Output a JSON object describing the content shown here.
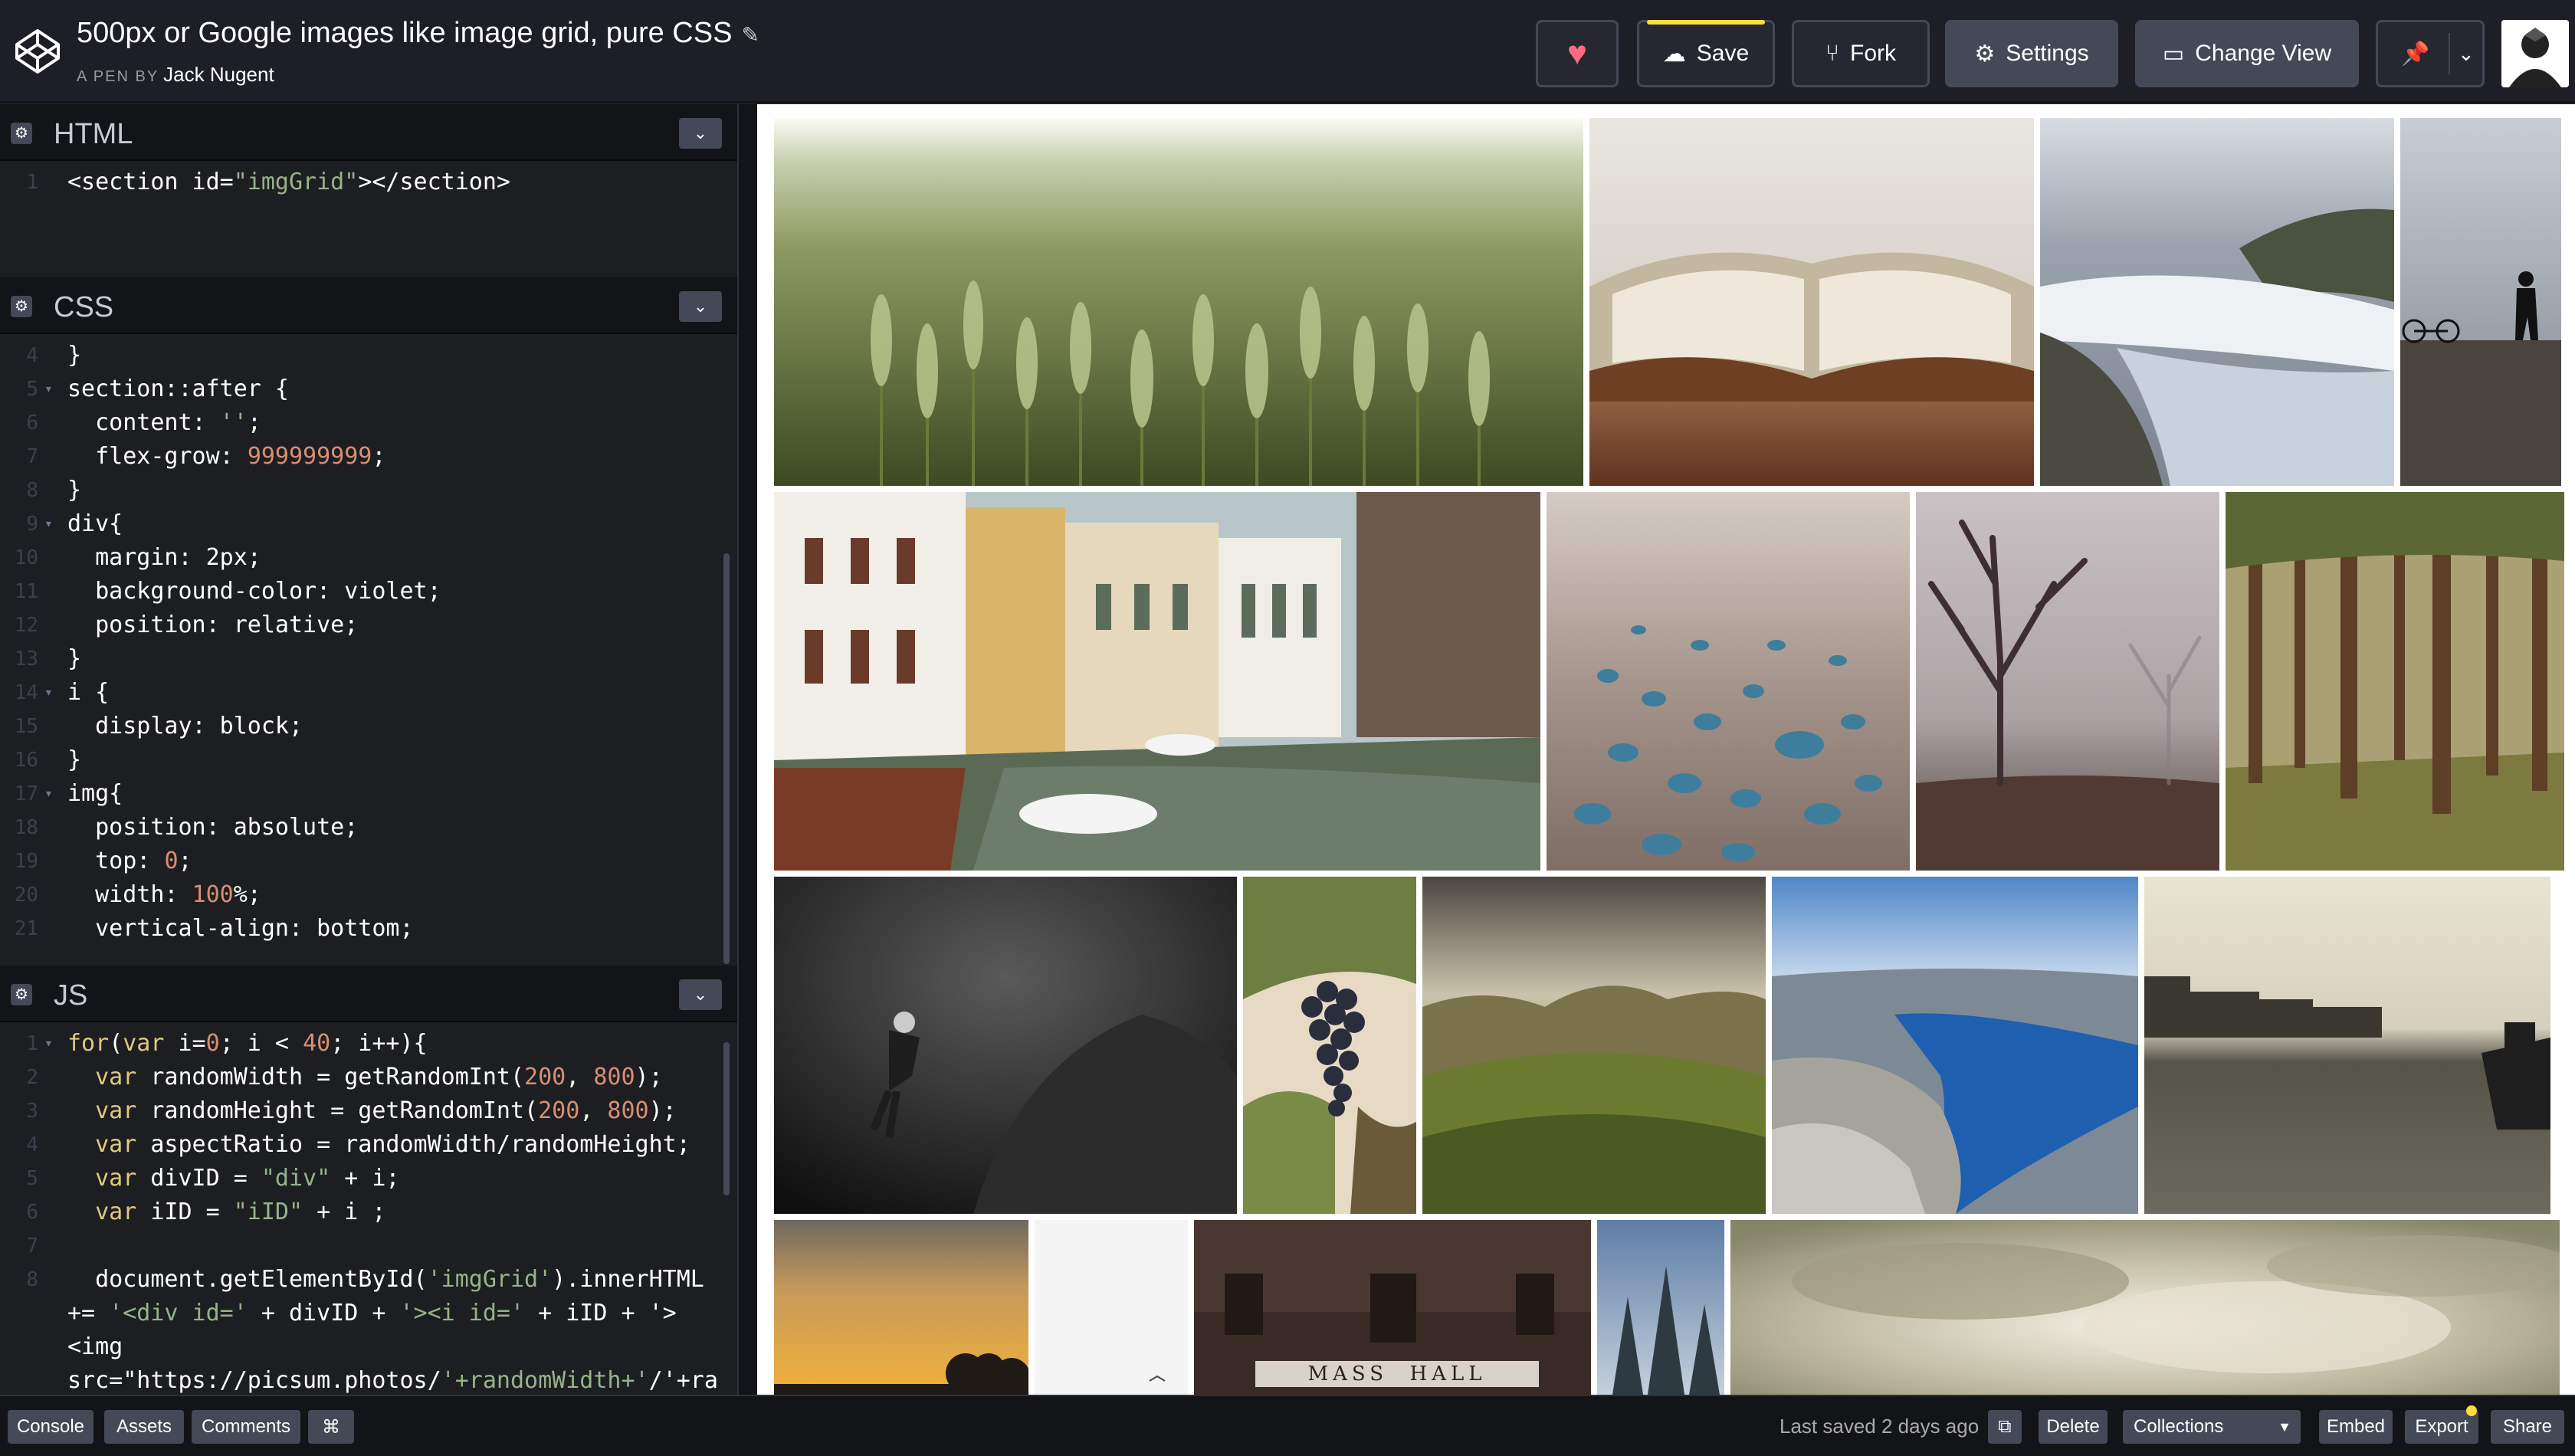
{
  "header": {
    "title": "500px or Google images like image grid, pure CSS",
    "pen_by_prefix": "A PEN BY",
    "author": "Jack Nugent",
    "buttons": {
      "save": "Save",
      "fork": "Fork",
      "settings": "Settings",
      "change_view": "Change View"
    },
    "icons": {
      "heart": "heart-icon",
      "save": "cloud-icon",
      "fork": "fork-icon",
      "settings": "gear-icon",
      "change_view": "view-icon",
      "pin": "pin-icon"
    }
  },
  "editors": {
    "html": {
      "title": "HTML",
      "lines": [
        {
          "n": "1",
          "code": "<section id=\"imgGrid\"></section>"
        }
      ]
    },
    "css": {
      "title": "CSS",
      "lines": [
        {
          "n": "4",
          "code": "}"
        },
        {
          "n": "5",
          "code": "section::after {"
        },
        {
          "n": "6",
          "code": "  content: '';"
        },
        {
          "n": "7",
          "code": "  flex-grow: 999999999;"
        },
        {
          "n": "8",
          "code": "}"
        },
        {
          "n": "9",
          "code": "div{"
        },
        {
          "n": "10",
          "code": "  margin: 2px;"
        },
        {
          "n": "11",
          "code": "  background-color: violet;"
        },
        {
          "n": "12",
          "code": "  position: relative;"
        },
        {
          "n": "13",
          "code": "}"
        },
        {
          "n": "14",
          "code": "i {"
        },
        {
          "n": "15",
          "code": "  display: block;"
        },
        {
          "n": "16",
          "code": "}"
        },
        {
          "n": "17",
          "code": "img{"
        },
        {
          "n": "18",
          "code": "  position: absolute;"
        },
        {
          "n": "19",
          "code": "  top: 0;"
        },
        {
          "n": "20",
          "code": "  width: 100%;"
        },
        {
          "n": "21",
          "code": "  vertical-align: bottom;"
        }
      ]
    },
    "js": {
      "title": "JS",
      "lines": [
        {
          "n": "1",
          "code": "for(var i=0; i < 40; i++){"
        },
        {
          "n": "2",
          "code": "  var randomWidth = getRandomInt(200, 800);"
        },
        {
          "n": "3",
          "code": "  var randomHeight = getRandomInt(200, 800);"
        },
        {
          "n": "4",
          "code": "  var aspectRatio = randomWidth/randomHeight;"
        },
        {
          "n": "5",
          "code": "  var divID = \"div\" + i;"
        },
        {
          "n": "6",
          "code": "  var iID = \"iID\" + i ;"
        },
        {
          "n": "7",
          "code": ""
        },
        {
          "n": "8",
          "code": "  document.getElementById('imgGrid').innerHTML"
        },
        {
          "n": "",
          "code": "+= '<div id=' + divID + '><i id=' + iID + '>"
        },
        {
          "n": "",
          "code": "<img"
        },
        {
          "n": "",
          "code": "src=\"https://picsum.photos/'+randomWidth+'/'+ra"
        }
      ]
    }
  },
  "preview": {
    "photos": [
      "wheat-field-photo",
      "open-book-photo",
      "waterfall-photo",
      "person-silhouette-photo",
      "canal-town-photo",
      "water-droplets-photo",
      "foggy-tree-photo",
      "pine-forest-photo",
      "scuba-diver-photo",
      "grapes-photo",
      "valley-photo",
      "fjord-photo",
      "harbor-photo",
      "sunset-photo",
      "white-photo",
      "mass-hall-photo",
      "pine-trees-photo",
      "cloudy-sky-photo"
    ],
    "signs": {
      "mass_hall": "MASS  HALL"
    }
  },
  "footer": {
    "console": "Console",
    "assets": "Assets",
    "comments": "Comments",
    "shortcuts": "⌘",
    "last_saved": "Last saved 2 days ago",
    "delete": "Delete",
    "collections": "Collections",
    "embed": "Embed",
    "export": "Export",
    "share": "Share"
  }
}
